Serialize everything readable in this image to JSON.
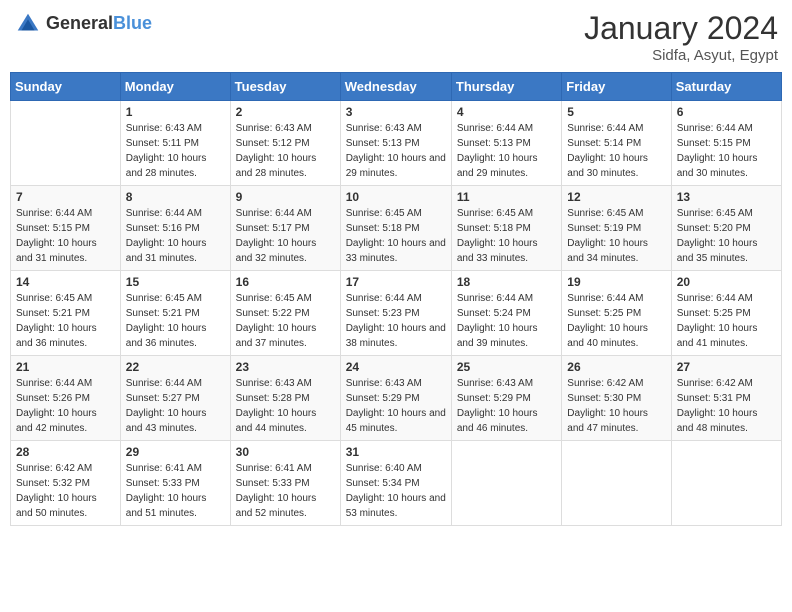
{
  "header": {
    "logo_general": "General",
    "logo_blue": "Blue",
    "month_year": "January 2024",
    "location": "Sidfa, Asyut, Egypt"
  },
  "days_of_week": [
    "Sunday",
    "Monday",
    "Tuesday",
    "Wednesday",
    "Thursday",
    "Friday",
    "Saturday"
  ],
  "weeks": [
    [
      {
        "day": "",
        "info": ""
      },
      {
        "day": "1",
        "info": "Sunrise: 6:43 AM\nSunset: 5:11 PM\nDaylight: 10 hours and 28 minutes."
      },
      {
        "day": "2",
        "info": "Sunrise: 6:43 AM\nSunset: 5:12 PM\nDaylight: 10 hours and 28 minutes."
      },
      {
        "day": "3",
        "info": "Sunrise: 6:43 AM\nSunset: 5:13 PM\nDaylight: 10 hours and 29 minutes."
      },
      {
        "day": "4",
        "info": "Sunrise: 6:44 AM\nSunset: 5:13 PM\nDaylight: 10 hours and 29 minutes."
      },
      {
        "day": "5",
        "info": "Sunrise: 6:44 AM\nSunset: 5:14 PM\nDaylight: 10 hours and 30 minutes."
      },
      {
        "day": "6",
        "info": "Sunrise: 6:44 AM\nSunset: 5:15 PM\nDaylight: 10 hours and 30 minutes."
      }
    ],
    [
      {
        "day": "7",
        "info": "Sunrise: 6:44 AM\nSunset: 5:15 PM\nDaylight: 10 hours and 31 minutes."
      },
      {
        "day": "8",
        "info": "Sunrise: 6:44 AM\nSunset: 5:16 PM\nDaylight: 10 hours and 31 minutes."
      },
      {
        "day": "9",
        "info": "Sunrise: 6:44 AM\nSunset: 5:17 PM\nDaylight: 10 hours and 32 minutes."
      },
      {
        "day": "10",
        "info": "Sunrise: 6:45 AM\nSunset: 5:18 PM\nDaylight: 10 hours and 33 minutes."
      },
      {
        "day": "11",
        "info": "Sunrise: 6:45 AM\nSunset: 5:18 PM\nDaylight: 10 hours and 33 minutes."
      },
      {
        "day": "12",
        "info": "Sunrise: 6:45 AM\nSunset: 5:19 PM\nDaylight: 10 hours and 34 minutes."
      },
      {
        "day": "13",
        "info": "Sunrise: 6:45 AM\nSunset: 5:20 PM\nDaylight: 10 hours and 35 minutes."
      }
    ],
    [
      {
        "day": "14",
        "info": "Sunrise: 6:45 AM\nSunset: 5:21 PM\nDaylight: 10 hours and 36 minutes."
      },
      {
        "day": "15",
        "info": "Sunrise: 6:45 AM\nSunset: 5:21 PM\nDaylight: 10 hours and 36 minutes."
      },
      {
        "day": "16",
        "info": "Sunrise: 6:45 AM\nSunset: 5:22 PM\nDaylight: 10 hours and 37 minutes."
      },
      {
        "day": "17",
        "info": "Sunrise: 6:44 AM\nSunset: 5:23 PM\nDaylight: 10 hours and 38 minutes."
      },
      {
        "day": "18",
        "info": "Sunrise: 6:44 AM\nSunset: 5:24 PM\nDaylight: 10 hours and 39 minutes."
      },
      {
        "day": "19",
        "info": "Sunrise: 6:44 AM\nSunset: 5:25 PM\nDaylight: 10 hours and 40 minutes."
      },
      {
        "day": "20",
        "info": "Sunrise: 6:44 AM\nSunset: 5:25 PM\nDaylight: 10 hours and 41 minutes."
      }
    ],
    [
      {
        "day": "21",
        "info": "Sunrise: 6:44 AM\nSunset: 5:26 PM\nDaylight: 10 hours and 42 minutes."
      },
      {
        "day": "22",
        "info": "Sunrise: 6:44 AM\nSunset: 5:27 PM\nDaylight: 10 hours and 43 minutes."
      },
      {
        "day": "23",
        "info": "Sunrise: 6:43 AM\nSunset: 5:28 PM\nDaylight: 10 hours and 44 minutes."
      },
      {
        "day": "24",
        "info": "Sunrise: 6:43 AM\nSunset: 5:29 PM\nDaylight: 10 hours and 45 minutes."
      },
      {
        "day": "25",
        "info": "Sunrise: 6:43 AM\nSunset: 5:29 PM\nDaylight: 10 hours and 46 minutes."
      },
      {
        "day": "26",
        "info": "Sunrise: 6:42 AM\nSunset: 5:30 PM\nDaylight: 10 hours and 47 minutes."
      },
      {
        "day": "27",
        "info": "Sunrise: 6:42 AM\nSunset: 5:31 PM\nDaylight: 10 hours and 48 minutes."
      }
    ],
    [
      {
        "day": "28",
        "info": "Sunrise: 6:42 AM\nSunset: 5:32 PM\nDaylight: 10 hours and 50 minutes."
      },
      {
        "day": "29",
        "info": "Sunrise: 6:41 AM\nSunset: 5:33 PM\nDaylight: 10 hours and 51 minutes."
      },
      {
        "day": "30",
        "info": "Sunrise: 6:41 AM\nSunset: 5:33 PM\nDaylight: 10 hours and 52 minutes."
      },
      {
        "day": "31",
        "info": "Sunrise: 6:40 AM\nSunset: 5:34 PM\nDaylight: 10 hours and 53 minutes."
      },
      {
        "day": "",
        "info": ""
      },
      {
        "day": "",
        "info": ""
      },
      {
        "day": "",
        "info": ""
      }
    ]
  ]
}
